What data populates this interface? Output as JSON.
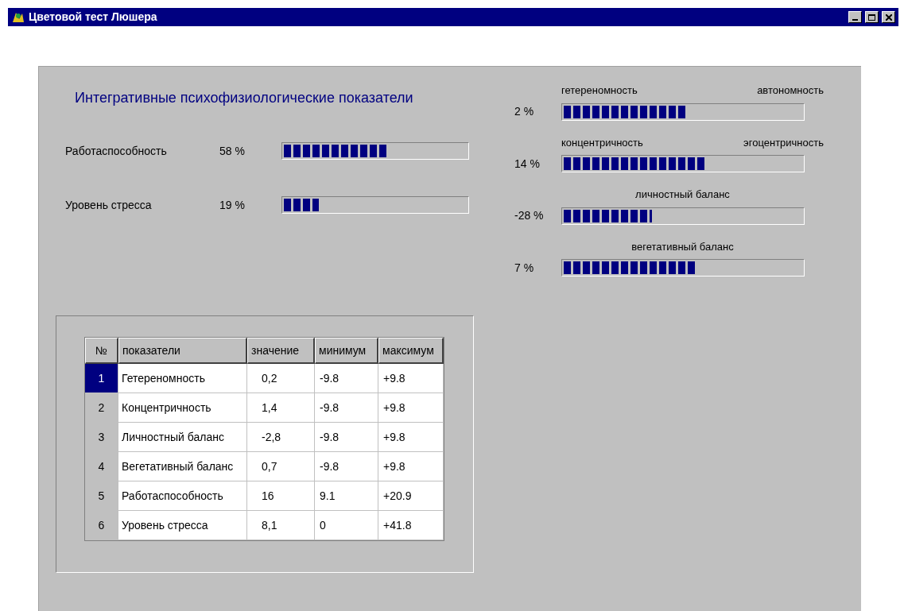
{
  "window": {
    "title": "Цветовой тест Люшера"
  },
  "heading": "Интегративные психофизиологические показатели",
  "indicators": [
    {
      "label": "Работаспособность",
      "reading": "58 %",
      "level": 0.57
    },
    {
      "label": "Уровень стресса",
      "reading": "19 %",
      "level": 0.19
    }
  ],
  "scales": [
    {
      "kind": "pair",
      "left_label": "гетереномность",
      "right_label": "автономность",
      "reading": "2 %",
      "level": 0.52
    },
    {
      "kind": "pair",
      "left_label": "концентричность",
      "right_label": "эгоцентричность",
      "reading": "14 %",
      "level": 0.59
    },
    {
      "kind": "centered",
      "label": "личностный баланс",
      "reading": "-28 %",
      "level": 0.37
    },
    {
      "kind": "centered",
      "label": "вегетативный баланс",
      "reading": "7 %",
      "level": 0.56
    }
  ],
  "table": {
    "columns": [
      "№",
      "показатели",
      "значение",
      "минимум",
      "максимум"
    ],
    "rows": [
      {
        "selected": true,
        "cells": [
          "1",
          "Гетереномность",
          "0,2",
          "-9.8",
          "+9.8"
        ]
      },
      {
        "selected": false,
        "cells": [
          "2",
          "Концентричность",
          "1,4",
          "-9.8",
          "+9.8"
        ]
      },
      {
        "selected": false,
        "cells": [
          "3",
          "Личностный баланс",
          "-2,8",
          "-9.8",
          "+9.8"
        ]
      },
      {
        "selected": false,
        "cells": [
          "4",
          "Вегетативный баланс",
          "0,7",
          "-9.8",
          "+9.8"
        ]
      },
      {
        "selected": false,
        "cells": [
          "5",
          "Работаспособность",
          "16",
          "9.1",
          "+20.9"
        ]
      },
      {
        "selected": false,
        "cells": [
          "6",
          "Уровень стресса",
          "8,1",
          "0",
          "+41.8"
        ]
      }
    ]
  }
}
